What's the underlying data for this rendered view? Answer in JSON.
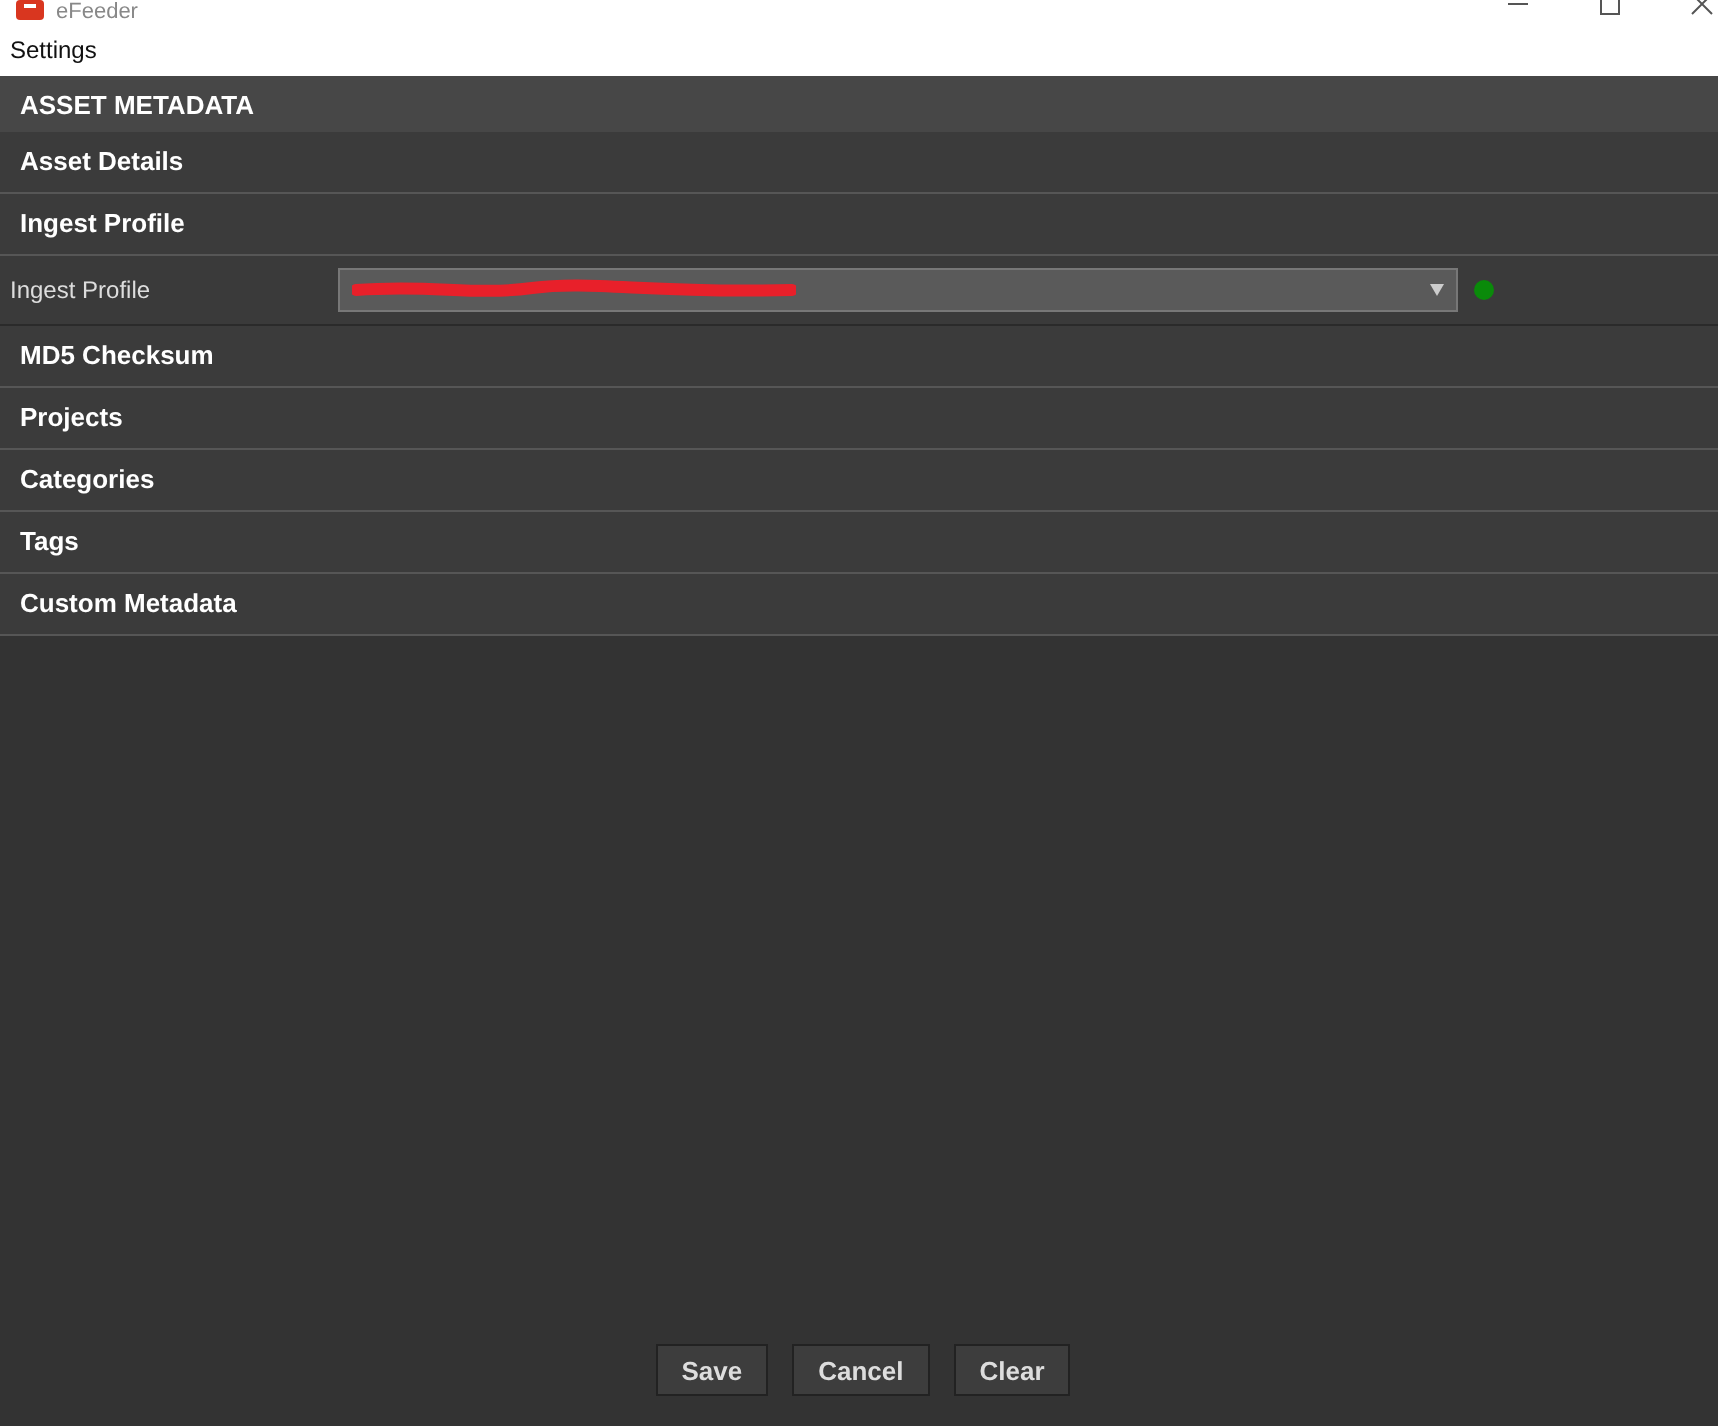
{
  "window": {
    "title": "eFeeder"
  },
  "menu": [
    "Settings"
  ],
  "panel": {
    "title": "ASSET METADATA"
  },
  "sections": [
    {
      "title": "Asset Details"
    },
    {
      "title": "Ingest Profile",
      "field": {
        "label": "Ingest Profile",
        "color": "#0a8a0a"
      }
    },
    {
      "title": "MD5 Checksum"
    },
    {
      "title": "Projects"
    },
    {
      "title": "Categories"
    },
    {
      "title": "Tags"
    },
    {
      "title": "Custom Metadata"
    }
  ],
  "buttons": [
    "Save",
    "Cancel",
    "Clear"
  ]
}
